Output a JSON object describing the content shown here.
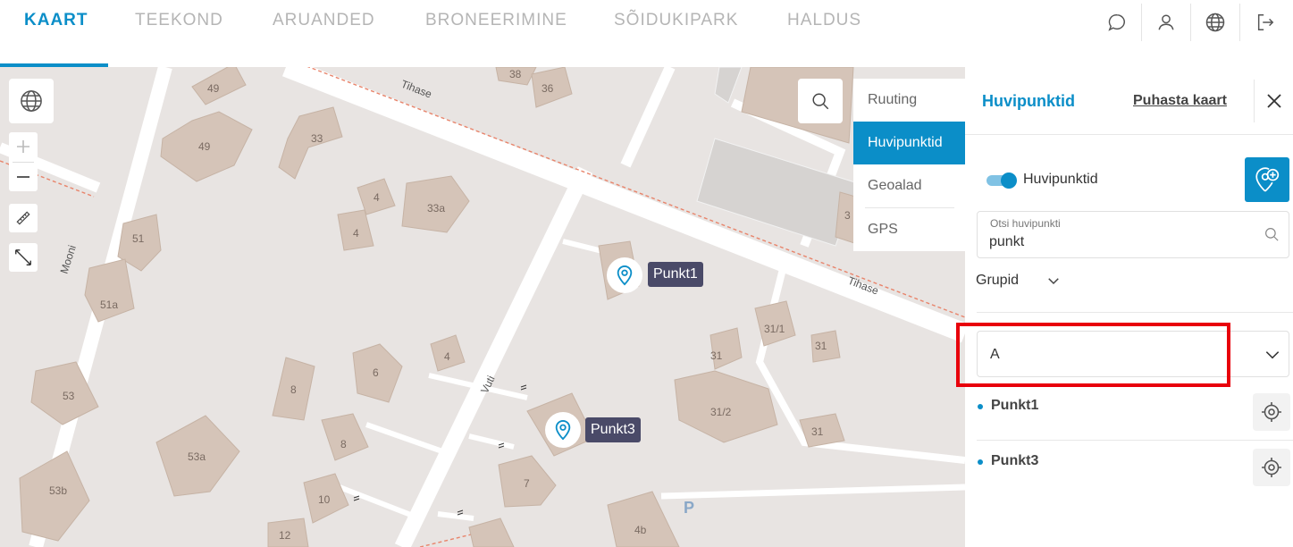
{
  "nav": {
    "tabs": [
      {
        "label": "KAART",
        "active": true
      },
      {
        "label": "TEEKOND",
        "active": false
      },
      {
        "label": "ARUANDED",
        "active": false
      },
      {
        "label": "BRONEERIMINE",
        "active": false
      },
      {
        "label": "SÕIDUKIPARK",
        "active": false
      },
      {
        "label": "HALDUS",
        "active": false
      }
    ],
    "icons": [
      "chat-icon",
      "user-icon",
      "globe-icon",
      "logout-icon"
    ]
  },
  "map": {
    "streets": [
      "Tihase",
      "Tihase",
      "Mooni",
      "Vuti"
    ],
    "buildings": [
      "49",
      "49",
      "33",
      "38",
      "36",
      "4",
      "4",
      "33a",
      "51",
      "51a",
      "53",
      "53a",
      "53b",
      "8",
      "6",
      "4",
      "8",
      "10",
      "12",
      "7",
      "4b",
      "31",
      "31/1",
      "31",
      "31/2",
      "31",
      "3"
    ],
    "layers": [
      {
        "label": "Ruuting",
        "active": false
      },
      {
        "label": "Huvipunktid",
        "active": true
      },
      {
        "label": "Geoalad",
        "active": false
      },
      {
        "label": "GPS",
        "active": false
      }
    ],
    "markers": [
      {
        "label": "Punkt1"
      },
      {
        "label": "Punkt3"
      }
    ],
    "parking": "P"
  },
  "panel": {
    "title": "Huvipunktid",
    "clear_label": "Puhasta kaart",
    "toggle_label": "Huvipunktid",
    "toggle_on": true,
    "search": {
      "legend": "Otsi huvipunkti",
      "value": "punkt"
    },
    "groups_label": "Grupid",
    "group_select": "A",
    "items": [
      {
        "name": "Punkt1"
      },
      {
        "name": "Punkt3"
      }
    ]
  },
  "colors": {
    "accent": "#0b8ec8",
    "highlight": "#e8000b",
    "map_bg": "#e8e4e2",
    "building": "#d5c4b8",
    "road": "#ffffff"
  }
}
